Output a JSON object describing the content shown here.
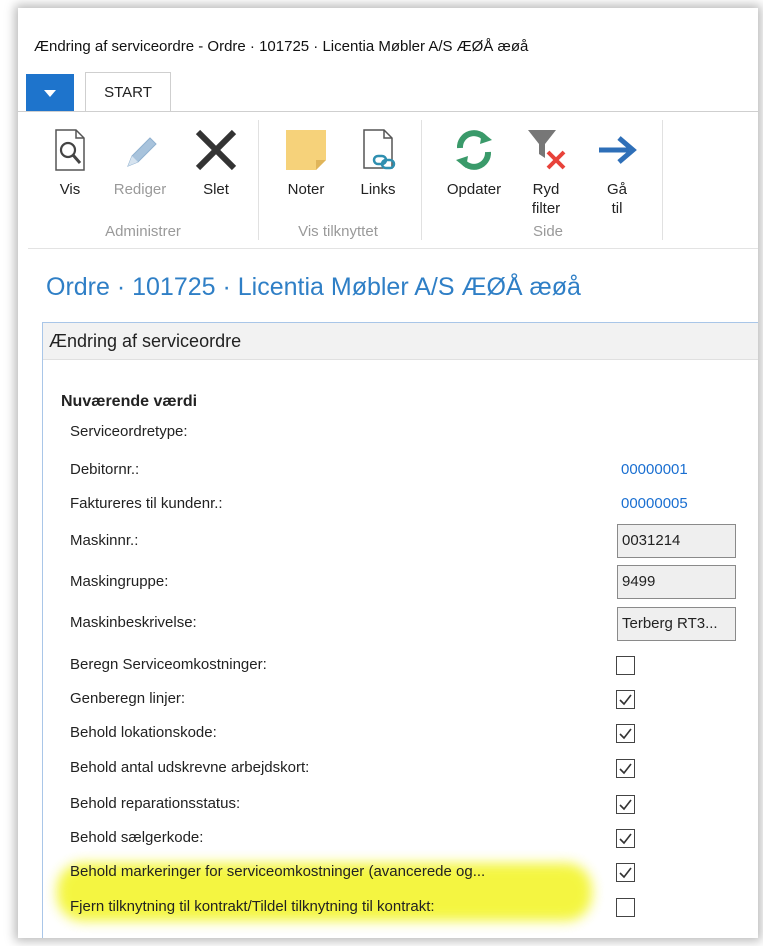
{
  "window": {
    "title": "Ændring af serviceordre - Ordre · 101725 · Licentia Møbler A/S ÆØÅ æøå"
  },
  "tabs": [
    {
      "label": "START",
      "selected": true
    }
  ],
  "ribbon": {
    "groups": [
      {
        "label": "Administrer",
        "buttons": [
          {
            "label": "Vis",
            "icon": "view-icon",
            "enabled": true
          },
          {
            "label": "Rediger",
            "icon": "edit-icon",
            "enabled": false
          },
          {
            "label": "Slet",
            "icon": "delete-icon",
            "enabled": true
          }
        ]
      },
      {
        "label": "Vis tilknyttet",
        "buttons": [
          {
            "label": "Noter",
            "icon": "notes-icon",
            "enabled": true
          },
          {
            "label": "Links",
            "icon": "links-icon",
            "enabled": true
          }
        ]
      },
      {
        "label": "Side",
        "buttons": [
          {
            "label": "Opdater",
            "icon": "refresh-icon",
            "enabled": true
          },
          {
            "label_line1": "Ryd",
            "label_line2": "filter",
            "icon": "clear-filter-icon",
            "enabled": true
          },
          {
            "label_line1": "Gå",
            "label_line2": "til",
            "icon": "goto-arrow-icon",
            "enabled": true
          }
        ]
      }
    ]
  },
  "page_title": "Ordre · 101725 · Licentia Møbler A/S ÆØÅ æøå",
  "panel": {
    "title": "Ændring af serviceordre",
    "section_title": "Nuværende værdi",
    "fields": [
      {
        "label": "Serviceordretype:",
        "type": "text",
        "value": ""
      },
      {
        "label": "Debitornr.:",
        "type": "link",
        "value": "00000001"
      },
      {
        "label": "Faktureres til kundenr.:",
        "type": "link",
        "value": "00000005"
      },
      {
        "label": "Maskinnr.:",
        "type": "input",
        "value": "0031214"
      },
      {
        "label": "Maskingruppe:",
        "type": "input",
        "value": "9499"
      },
      {
        "label": "Maskinbeskrivelse:",
        "type": "input",
        "value": "Terberg RT3..."
      },
      {
        "label": "Beregn Serviceomkostninger:",
        "type": "checkbox",
        "checked": false
      },
      {
        "label": "Genberegn linjer:",
        "type": "checkbox",
        "checked": true
      },
      {
        "label": "Behold lokationskode:",
        "type": "checkbox",
        "checked": true
      },
      {
        "label": "Behold antal udskrevne arbejdskort:",
        "type": "checkbox",
        "checked": true
      },
      {
        "label": "Behold reparationsstatus:",
        "type": "checkbox",
        "checked": true
      },
      {
        "label": "Behold sælgerkode:",
        "type": "checkbox",
        "checked": true
      },
      {
        "label": "Behold markeringer for serviceomkostninger (avancerede og...",
        "type": "checkbox",
        "checked": true
      },
      {
        "label": "Fjern tilknytning til kontrakt/Tildel tilknytning til kontrakt:",
        "type": "checkbox",
        "checked": false,
        "highlighted": true
      }
    ]
  },
  "colors": {
    "accent_blue": "#1e74cc",
    "title_blue": "#2f7fc6",
    "link_blue": "#1a6fd1",
    "highlight_yellow": "#f3f52d",
    "refresh_green": "#3a9a6a",
    "clear_filter_red": "#e8423a"
  }
}
